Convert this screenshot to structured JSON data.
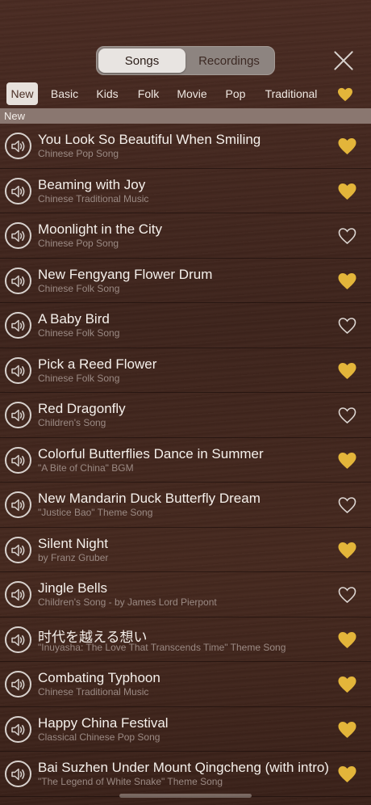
{
  "segmented": {
    "songs": "Songs",
    "recordings": "Recordings",
    "selected": "Songs"
  },
  "categories": [
    "New",
    "Basic",
    "Kids",
    "Folk",
    "Movie",
    "Pop",
    "Traditional"
  ],
  "active_category": "New",
  "section_title": "New",
  "colors": {
    "favorite": "#e3b53a",
    "unfavorite_outline": "#dcd6d2"
  },
  "songs": [
    {
      "title": "You Look So Beautiful When Smiling",
      "subtitle": "Chinese Pop Song",
      "favorite": true
    },
    {
      "title": "Beaming with Joy",
      "subtitle": "Chinese Traditional Music",
      "favorite": true
    },
    {
      "title": "Moonlight in the City",
      "subtitle": "Chinese Pop Song",
      "favorite": false
    },
    {
      "title": "New Fengyang Flower Drum",
      "subtitle": "Chinese Folk Song",
      "favorite": true
    },
    {
      "title": "A Baby Bird",
      "subtitle": "Chinese Folk Song",
      "favorite": false
    },
    {
      "title": "Pick a Reed Flower",
      "subtitle": "Chinese Folk Song",
      "favorite": true
    },
    {
      "title": "Red Dragonfly",
      "subtitle": "Children's Song",
      "favorite": false
    },
    {
      "title": "Colorful Butterflies Dance in Summer",
      "subtitle": "\"A Bite of China\" BGM",
      "favorite": true
    },
    {
      "title": "New Mandarin Duck Butterfly Dream",
      "subtitle": "\"Justice Bao\" Theme Song",
      "favorite": false
    },
    {
      "title": "Silent Night",
      "subtitle": "by Franz Gruber",
      "favorite": true
    },
    {
      "title": "Jingle Bells",
      "subtitle": "Children's Song - by James Lord Pierpont",
      "favorite": false
    },
    {
      "title": "时代を越える想い",
      "subtitle": "\"Inuyasha: The Love That Transcends Time\" Theme Song",
      "favorite": true
    },
    {
      "title": "Combating Typhoon",
      "subtitle": "Chinese Traditional Music",
      "favorite": true
    },
    {
      "title": "Happy China Festival",
      "subtitle": "Classical Chinese Pop Song",
      "favorite": true
    },
    {
      "title": "Bai Suzhen Under Mount Qingcheng (with intro)",
      "subtitle": "\"The Legend of White Snake\" Theme Song",
      "favorite": true
    }
  ]
}
